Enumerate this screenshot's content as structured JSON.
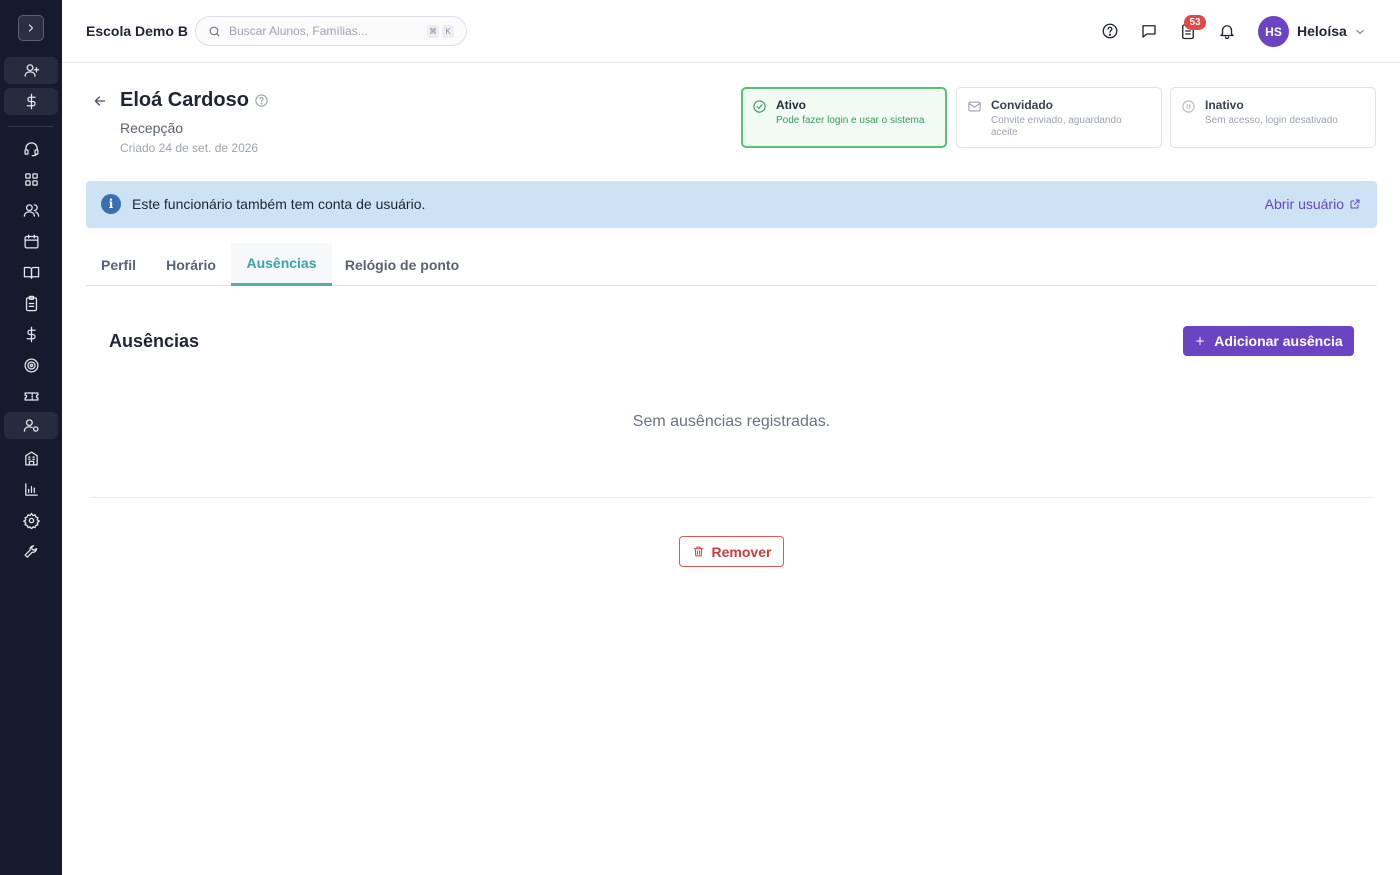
{
  "topbar": {
    "school_name": "Escola Demo B",
    "search_placeholder": "Buscar Alunos, Famílias...",
    "search_shortcut": [
      "⌘",
      "K"
    ],
    "notifications_count": "53",
    "user_initials": "HS",
    "user_name": "Heloísa"
  },
  "sidebar": {
    "items": [
      {
        "icon": "user-plus-icon",
        "highlighted": true
      },
      {
        "icon": "dollar-icon",
        "highlighted": true
      },
      {
        "icon": "headset-icon"
      },
      {
        "icon": "dashboard-grid-icon"
      },
      {
        "icon": "users-icon"
      },
      {
        "icon": "calendar-icon"
      },
      {
        "icon": "book-icon"
      },
      {
        "icon": "clipboard-icon"
      },
      {
        "icon": "dollar-icon"
      },
      {
        "icon": "target-icon"
      },
      {
        "icon": "ticket-icon"
      },
      {
        "icon": "user-cog-icon",
        "highlighted": true
      },
      {
        "icon": "building-icon"
      },
      {
        "icon": "bar-chart-icon"
      },
      {
        "icon": "gear-icon"
      },
      {
        "icon": "wrench-icon"
      }
    ]
  },
  "employee": {
    "name": "Eloá Cardoso",
    "role": "Recepção",
    "created": "Criado 24 de set. de 2026"
  },
  "status_options": [
    {
      "title": "Ativo",
      "description": "Pode fazer login e usar o sistema",
      "selected": true,
      "icon": "check-circle-icon"
    },
    {
      "title": "Convidado",
      "description": "Convite enviado, aguardando aceite",
      "selected": false,
      "icon": "mail-icon"
    },
    {
      "title": "Inativo",
      "description": "Sem acesso, login desativado",
      "selected": false,
      "icon": "pause-circle-icon"
    }
  ],
  "banner": {
    "message": "Este funcionário também tem conta de usuário.",
    "link_label": "Abrir usuário"
  },
  "tabs": [
    {
      "label": "Perfil",
      "active": false
    },
    {
      "label": "Horário",
      "active": false
    },
    {
      "label": "Ausências",
      "active": true
    },
    {
      "label": "Relógio de ponto",
      "active": false
    }
  ],
  "absences": {
    "title": "Ausências",
    "add_label": "Adicionar ausência",
    "empty_text": "Sem ausências registradas."
  },
  "remove_label": "Remover",
  "colors": {
    "sidebar_bg": "#161a2e",
    "accent_purple": "#6b44c4",
    "active_tab": "#38a5a5",
    "status_active_border": "#5bbf7a",
    "banner_bg": "#cde3f5",
    "danger": "#c73e3e",
    "badge": "#e24848"
  }
}
